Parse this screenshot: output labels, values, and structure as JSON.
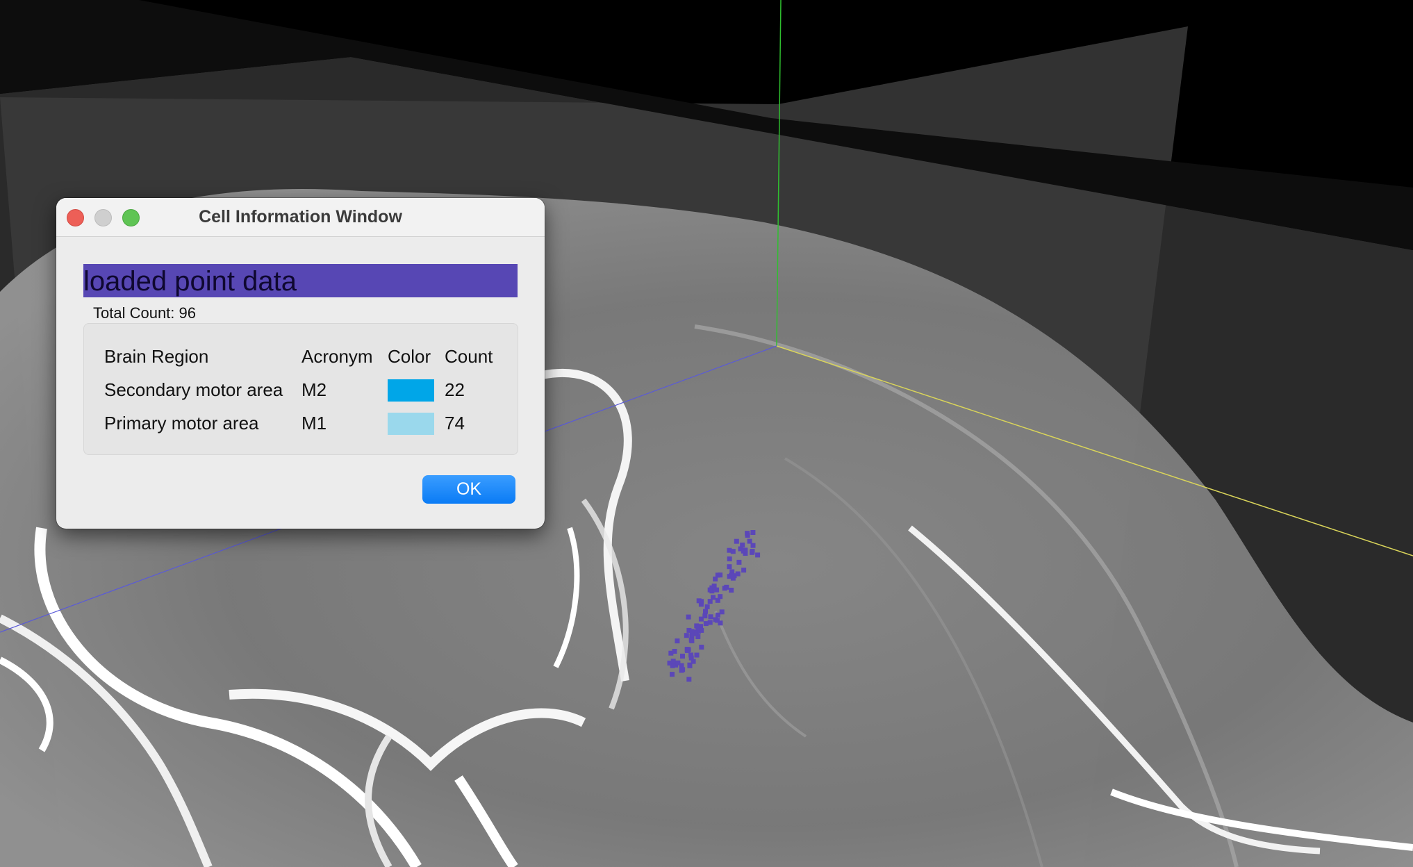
{
  "window": {
    "title": "Cell Information Window",
    "header_text": "loaded point data",
    "total_count": "Total Count: 96",
    "columns": [
      "Brain Region",
      "Acronym",
      "Color",
      "Count"
    ],
    "rows": [
      {
        "region": "Secondary motor area",
        "acronym": "M2",
        "color": "#00a6e8",
        "count": "22"
      },
      {
        "region": "Primary motor area",
        "acronym": "M1",
        "color": "#9ad8ec",
        "count": "74"
      }
    ],
    "ok_label": "OK"
  },
  "colors": {
    "header_bar": "#5747b4",
    "point_color": "#5b47b8",
    "axis_green": "#2fbf2f",
    "axis_yellow": "#d9d45a",
    "axis_blue": "#5a5ad8"
  }
}
